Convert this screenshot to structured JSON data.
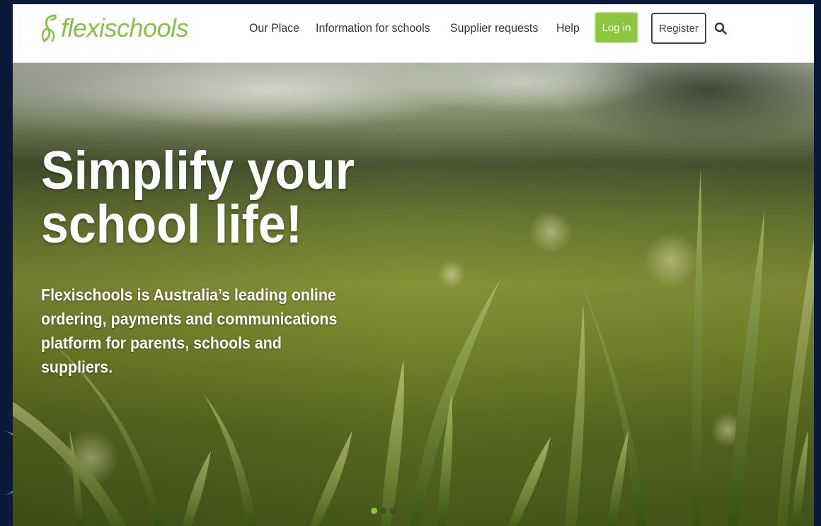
{
  "brand": {
    "name": "flexischools",
    "color": "#86c04a"
  },
  "nav": {
    "items": [
      {
        "label": "Our Place"
      },
      {
        "label": "Information for schools"
      },
      {
        "label": "Supplier requests"
      },
      {
        "label": "Help"
      }
    ],
    "login_label": "Log in",
    "register_label": "Register",
    "search_icon": "search-icon",
    "login_color": "#8cc63f"
  },
  "hero": {
    "title": "Simplify your school life!",
    "subtitle": "Flexischools is Australia’s leading online ordering, payments and communications platform for parents, schools and suppliers.",
    "carousel": {
      "slides": 3,
      "active_index": 0
    }
  }
}
